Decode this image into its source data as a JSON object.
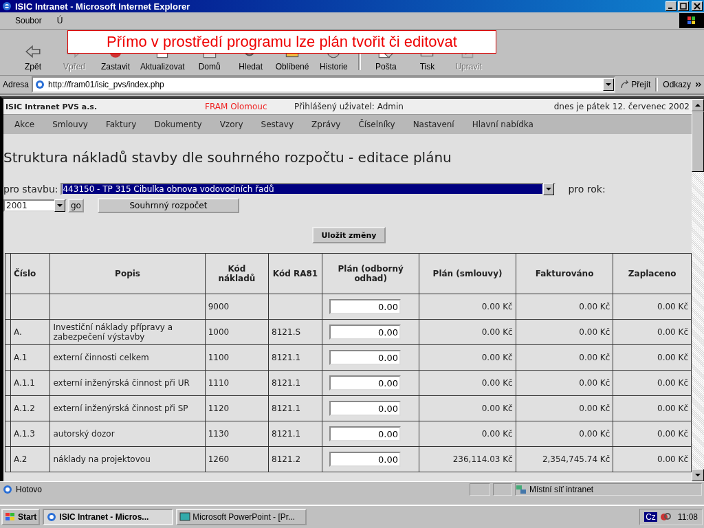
{
  "window": {
    "title": "ISIC Intranet - Microsoft Internet Explorer"
  },
  "menu": [
    "Soubor",
    "Ú"
  ],
  "toolbar": [
    {
      "label": "Zpět",
      "disabled": false
    },
    {
      "label": "Vpřed",
      "disabled": true
    },
    {
      "label": "Zastavit",
      "disabled": false
    },
    {
      "label": "Aktualizovat",
      "disabled": false
    },
    {
      "label": "Domů",
      "disabled": false
    },
    {
      "label": "Hledat",
      "disabled": false
    },
    {
      "label": "Oblíbené",
      "disabled": false
    },
    {
      "label": "Historie",
      "disabled": false
    },
    {
      "label": "Pošta",
      "disabled": false
    },
    {
      "label": "Tisk",
      "disabled": false
    },
    {
      "label": "Upravit",
      "disabled": true
    }
  ],
  "address": {
    "label": "Adresa",
    "url": "http://fram01/isic_pvs/index.php",
    "go": "Přejít",
    "links": "Odkazy"
  },
  "callout": "Přímo v prostředí programu lze plán tvořit či editovat",
  "page": {
    "header": {
      "company": "ISIC Intranet PVS a.s.",
      "branch": "FRAM Olomouc",
      "user": "Přihlášený uživatel: Admin",
      "date": "dnes je pátek 12. červenec 2002"
    },
    "nav": [
      "Akce",
      "Smlouvy",
      "Faktury",
      "Dokumenty",
      "Vzory",
      "Sestavy",
      "Zprávy",
      "Číselníky",
      "Nastavení",
      "Hlavní nabídka"
    ],
    "heading": "Struktura nákladů stavby dle souhrného rozpočtu - editace plánu",
    "form": {
      "site_label": "pro stavbu:",
      "site_value": "443150 - TP 315 Cibulka obnova vodovodních řadů",
      "year_label": "pro rok:",
      "year_value": "2001",
      "go": "go",
      "summary_button": "Souhrnný rozpočet"
    },
    "save_button": "Uložit změny",
    "table": {
      "columns": [
        "Číslo",
        "Popis",
        "Kód nákladů",
        "Kód RA81",
        "Plán (odborný odhad)",
        "Plán (smlouvy)",
        "Fakturováno",
        "Zaplaceno"
      ],
      "rows": [
        {
          "number": "",
          "description": "",
          "cost_code": "9000",
          "ra81": "",
          "plan_estimate": "0.00",
          "plan_contracts": "0.00 Kč",
          "invoiced": "0.00 Kč",
          "paid": "0.00 Kč"
        },
        {
          "number": "A.",
          "description": "Investiční náklady přípravy a zabezpečení výstavby",
          "cost_code": "1000",
          "ra81": "8121.S",
          "plan_estimate": "0.00",
          "plan_contracts": "0.00 Kč",
          "invoiced": "0.00 Kč",
          "paid": "0.00 Kč"
        },
        {
          "number": "A.1",
          "description": "externí činnosti celkem",
          "cost_code": "1100",
          "ra81": "8121.1",
          "plan_estimate": "0.00",
          "plan_contracts": "0.00 Kč",
          "invoiced": "0.00 Kč",
          "paid": "0.00 Kč"
        },
        {
          "number": "A.1.1",
          "description": "externí inženýrská činnost při UR",
          "cost_code": "1110",
          "ra81": "8121.1",
          "plan_estimate": "0.00",
          "plan_contracts": "0.00 Kč",
          "invoiced": "0.00 Kč",
          "paid": "0.00 Kč"
        },
        {
          "number": "A.1.2",
          "description": "externí inženýrská činnost při SP",
          "cost_code": "1120",
          "ra81": "8121.1",
          "plan_estimate": "0.00",
          "plan_contracts": "0.00 Kč",
          "invoiced": "0.00 Kč",
          "paid": "0.00 Kč"
        },
        {
          "number": "A.1.3",
          "description": "autorský dozor",
          "cost_code": "1130",
          "ra81": "8121.1",
          "plan_estimate": "0.00",
          "plan_contracts": "0.00 Kč",
          "invoiced": "0.00 Kč",
          "paid": "0.00 Kč"
        },
        {
          "number": "A.2",
          "description": "náklady na projektovou",
          "cost_code": "1260",
          "ra81": "8121.2",
          "plan_estimate": "0.00",
          "plan_contracts": "236,114.03 Kč",
          "invoiced": "2,354,745.74 Kč",
          "paid": "0.00 Kč"
        }
      ]
    }
  },
  "status_bar": {
    "text": "Hotovo",
    "zone": "Místní síť intranet"
  },
  "taskbar": {
    "start": "Start",
    "tasks": [
      {
        "label": "ISIC Intranet - Micros...",
        "selected": true
      },
      {
        "label": "Microsoft PowerPoint - [Pr...",
        "selected": false
      }
    ],
    "language": "Cz",
    "time": "11:08"
  }
}
